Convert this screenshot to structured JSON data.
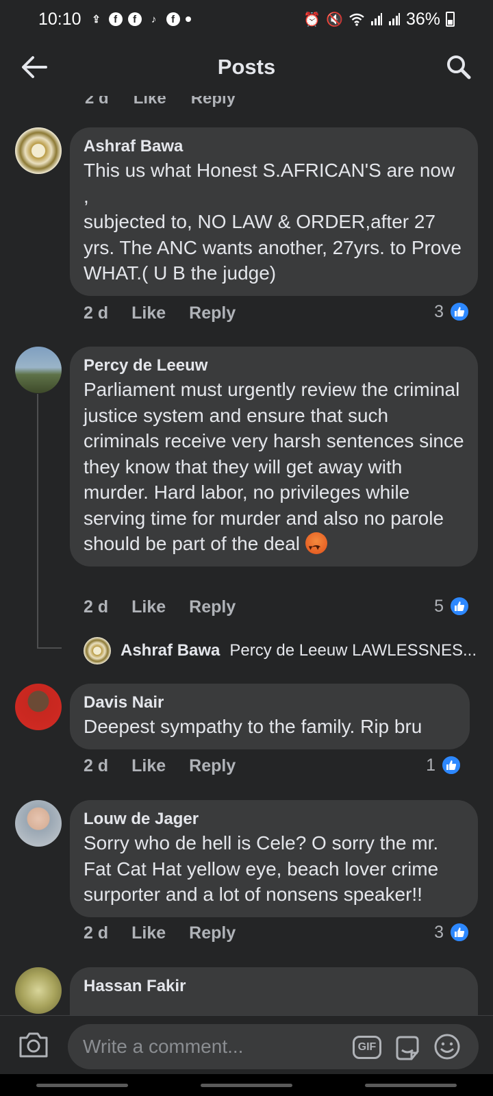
{
  "status_bar": {
    "time": "10:10",
    "notification_icons": [
      "person-upload-icon",
      "facebook-icon",
      "facebook-icon",
      "tiktok-icon",
      "facebook-icon",
      "dot-icon"
    ],
    "system_icons": [
      "alarm-icon",
      "mute-icon",
      "wifi-icon",
      "signal-icon",
      "signal-icon"
    ],
    "battery": "36%"
  },
  "header": {
    "title": "Posts"
  },
  "cut_off_actions": {
    "time": "2 d",
    "like": "Like",
    "reply": "Reply"
  },
  "comments": [
    {
      "author": "Ashraf Bawa",
      "text": "This us what Honest S.AFRICAN'S are now ,\nsubjected to, NO LAW & ORDER,after 27 yrs. The ANC wants another, 27yrs. to Prove WHAT.( U B the judge)",
      "time": "2 d",
      "like": "Like",
      "reply": "Reply",
      "reactions": "3"
    },
    {
      "author": "Percy de Leeuw",
      "text": "Parliament must urgently review the criminal justice system and ensure that such criminals receive very harsh sentences since they know that they will get away with murder. Hard labor, no privileges while serving time for murder and also no parole should be part of the deal ",
      "time": "2 d",
      "like": "Like",
      "reply": "Reply",
      "reactions": "5",
      "reply_preview": {
        "author": "Ashraf Bawa",
        "snippet": "Percy de Leeuw LAWLESSNES..."
      }
    },
    {
      "author": "Davis Nair",
      "text": "Deepest sympathy to the family. Rip bru",
      "time": "2 d",
      "like": "Like",
      "reply": "Reply",
      "reactions": "1"
    },
    {
      "author": "Louw de Jager",
      "text": "Sorry who de hell is Cele? O sorry the mr. Fat Cat Hat yellow eye, beach lover crime surporter and a lot of nonsens speaker!!",
      "time": "2 d",
      "like": "Like",
      "reply": "Reply",
      "reactions": "3"
    },
    {
      "author": "Hassan Fakir"
    }
  ],
  "composer": {
    "placeholder": "Write a comment...",
    "gif_label": "GIF"
  },
  "colors": {
    "background": "#242526",
    "bubble": "#3a3b3c",
    "like_blue": "#2d88ff",
    "secondary_text": "#b0b3b8"
  }
}
